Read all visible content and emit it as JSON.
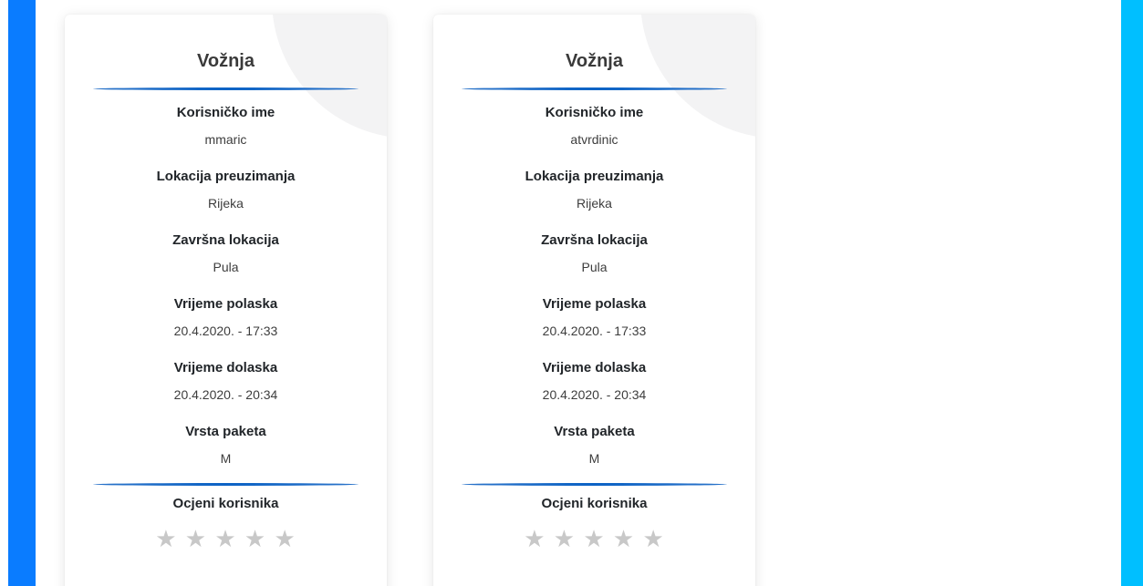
{
  "colors": {
    "left_bar": "#0a7cff",
    "right_bar": "#00bfff",
    "divider": "#0d63c5",
    "star_empty": "#c8c8c8"
  },
  "cards": [
    {
      "title": "Vožnja",
      "fields": [
        {
          "label": "Korisničko ime",
          "value": "mmaric"
        },
        {
          "label": "Lokacija preuzimanja",
          "value": "Rijeka"
        },
        {
          "label": "Završna lokacija",
          "value": "Pula"
        },
        {
          "label": "Vrijeme polaska",
          "value": "20.4.2020. - 17:33"
        },
        {
          "label": "Vrijeme dolaska",
          "value": "20.4.2020. - 20:34"
        },
        {
          "label": "Vrsta paketa",
          "value": "M"
        }
      ],
      "rating_label": "Ocjeni korisnika",
      "rating": {
        "max": 5,
        "value": 0,
        "star_glyph": "★"
      }
    },
    {
      "title": "Vožnja",
      "fields": [
        {
          "label": "Korisničko ime",
          "value": "atvrdinic"
        },
        {
          "label": "Lokacija preuzimanja",
          "value": "Rijeka"
        },
        {
          "label": "Završna lokacija",
          "value": "Pula"
        },
        {
          "label": "Vrijeme polaska",
          "value": "20.4.2020. - 17:33"
        },
        {
          "label": "Vrijeme dolaska",
          "value": "20.4.2020. - 20:34"
        },
        {
          "label": "Vrsta paketa",
          "value": "M"
        }
      ],
      "rating_label": "Ocjeni korisnika",
      "rating": {
        "max": 5,
        "value": 0,
        "star_glyph": "★"
      }
    }
  ]
}
